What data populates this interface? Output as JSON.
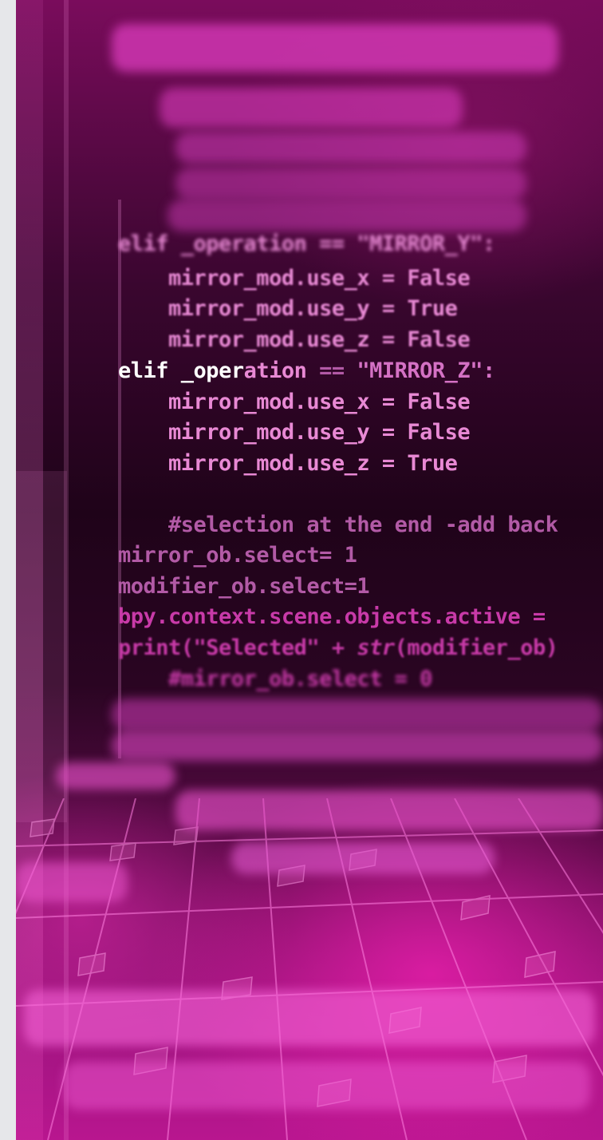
{
  "code_lines": [
    {
      "text": "elif _operation == \"MIRROR_Y\":"
    },
    {
      "text": "    mirror_mod.use_x = False"
    },
    {
      "text": "    mirror_mod.use_y = True"
    },
    {
      "text": "    mirror_mod.use_z = False"
    },
    {
      "keyword": "elif",
      "ident_a": "_oper",
      "ident_b": "ation",
      "op": " == ",
      "string": "\"MIRROR_Z\":"
    },
    {
      "text": "    mirror_mod.use_x = False"
    },
    {
      "text": "    mirror_mod.use_y = False"
    },
    {
      "text": "    mirror_mod.use_z = True"
    },
    {
      "text": "    #selection at the end -add back"
    },
    {
      "text": "mirror_ob.select= 1"
    },
    {
      "text": "modifier_ob.select=1"
    },
    {
      "text": "bpy.context.scene.objects.active ="
    },
    {
      "prefix": "print(\"Selected\" + ",
      "func": "str",
      "suffix": "(modifier_ob)"
    },
    {
      "text": "    #mirror_ob.select = 0"
    }
  ],
  "colors": {
    "highlight": "#ffffff",
    "code_pink": "#e889d4",
    "background_top": "#7a0c5c",
    "background_bottom": "#b8168f"
  }
}
